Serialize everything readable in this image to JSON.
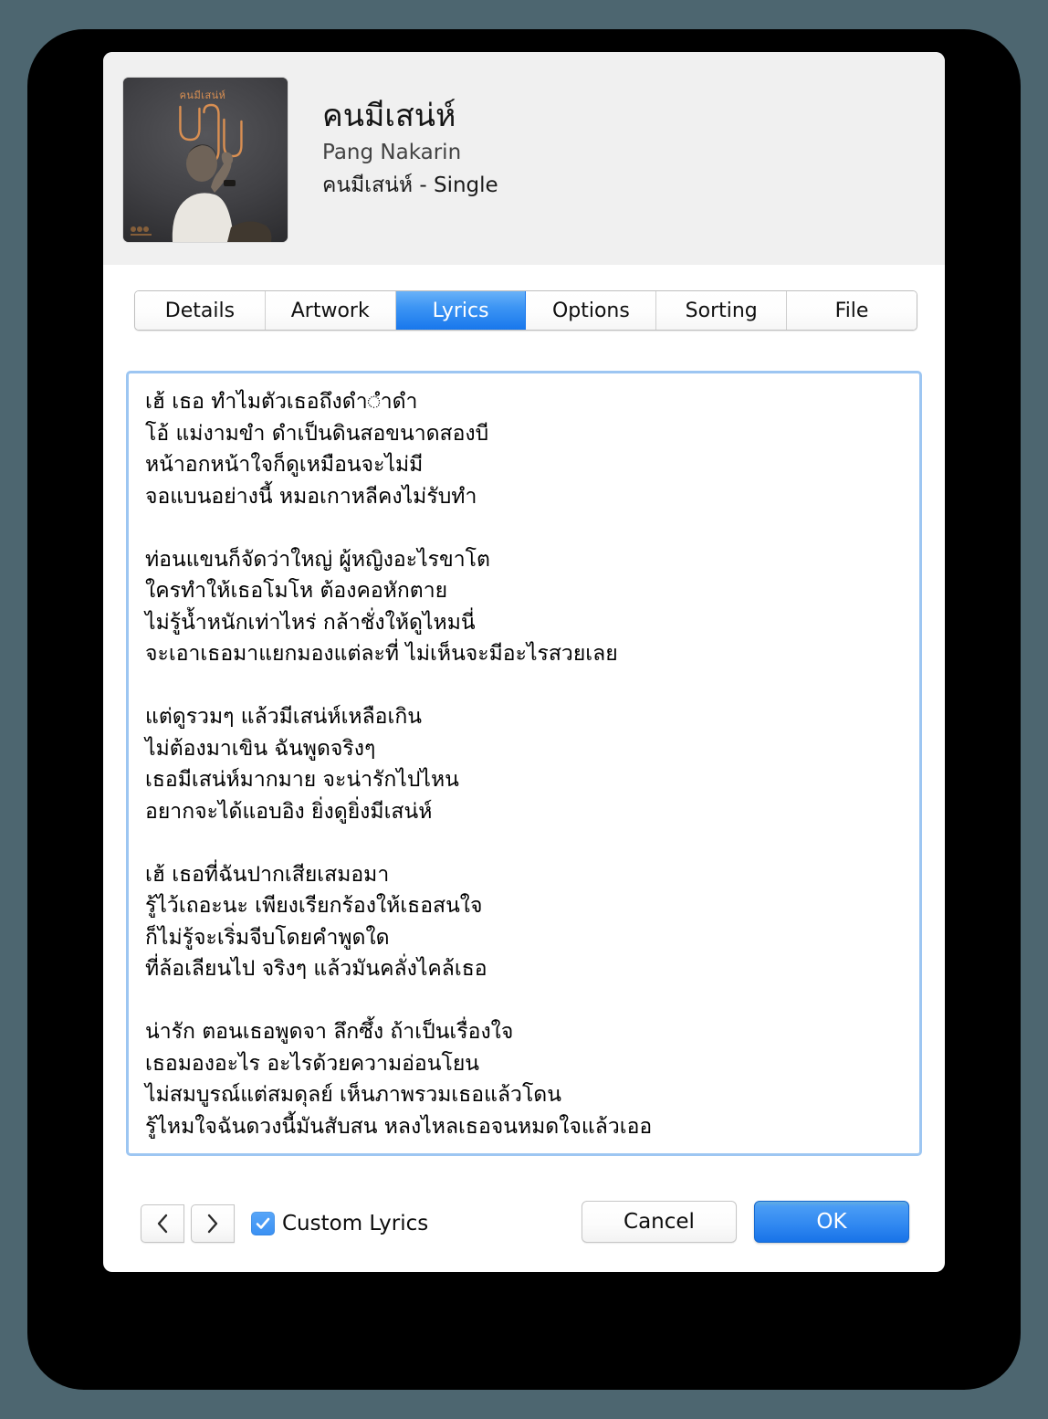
{
  "window": {
    "backdrop_color": "#4d6670",
    "frame_color": "#000000",
    "sheet_color": "#ffffff"
  },
  "header": {
    "title": "คนมีเสน่ห์",
    "artist": "Pang Nakarin",
    "album": "คนมีเสน่ห์ - Single",
    "artwork": {
      "alt": "album-artwork",
      "overlay_text_top": "คนมีเสน่ห์",
      "accent_color": "#d98f52",
      "background_color": "#3f3f43"
    }
  },
  "tabs": {
    "items": [
      {
        "label": "Details",
        "active": false
      },
      {
        "label": "Artwork",
        "active": false
      },
      {
        "label": "Lyrics",
        "active": true
      },
      {
        "label": "Options",
        "active": false
      },
      {
        "label": "Sorting",
        "active": false
      },
      {
        "label": "File",
        "active": false
      }
    ],
    "active_color": "#1877ec"
  },
  "lyrics": {
    "focused": true,
    "focus_border_color": "#9dc6f2",
    "text": "เฮ้ เธอ ทำไมตัวเธอถึงดำ◌ำดำ\nโอ้ แม่งามขำ ดำเป็นดินสอขนาดสองบี\nหน้าอกหน้าใจก็ดูเหมือนจะไม่มี\nจอแบนอย่างนี้ หมอเกาหลีคงไม่รับทำ\n\nท่อนแขนก็จัดว่าใหญ่ ผู้หญิงอะไรขาโต\nใครทำให้เธอโมโห ต้องคอหักตาย\nไม่รู้น้ำหนักเท่าไหร่ กล้าชั่งให้ดูไหมนี่\nจะเอาเธอมาแยกมองแต่ละที่ ไม่เห็นจะมีอะไรสวยเลย\n\nแต่ดูรวมๆ แล้วมีเสน่ห์เหลือเกิน\nไม่ต้องมาเขิน ฉันพูดจริงๆ\nเธอมีเสน่ห์มากมาย จะน่ารักไปไหน\nอยากจะได้แอบอิง ยิ่งดูยิ่งมีเสน่ห์\n\nเฮ้ เธอที่ฉันปากเสียเสมอมา\nรู้ไว้เถอะนะ เพียงเรียกร้องให้เธอสนใจ\nก็ไม่รู้จะเริ่มจีบโดยคำพูดใด\nที่ล้อเลียนไป จริงๆ แล้วมันคลั่งไคล้เธอ\n\nน่ารัก ตอนเธอพูดจา ลึกซึ้ง ถ้าเป็นเรื่องใจ\nเธอมองอะไร อะไรด้วยความอ่อนโยน\nไม่สมบูรณ์แต่สมดุลย์ เห็นภาพรวมเธอแล้วโดน\nรู้ไหมใจฉันดวงนี้มันสับสน หลงไหลเธอจนหมดใจแล้วเออ"
  },
  "bottom": {
    "prev_icon": "chevron-left-icon",
    "next_icon": "chevron-right-icon",
    "prev_glyph": "‹",
    "next_glyph": "›",
    "custom_lyrics_label": "Custom Lyrics",
    "custom_lyrics_checked": true,
    "checkbox_color": "#3a90f3",
    "cancel_label": "Cancel",
    "ok_label": "OK",
    "ok_color": "#1873e8"
  }
}
